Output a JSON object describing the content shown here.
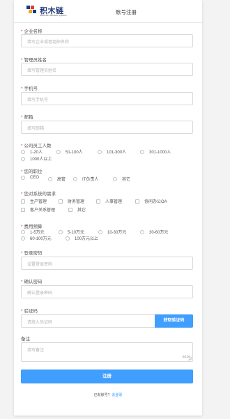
{
  "header": {
    "logo_text": "积木链",
    "logo_sub": "JIMULIAN Software Systems",
    "title": "账号注册"
  },
  "fields": {
    "company": {
      "label": "企业名称",
      "placeholder": "填写企业或者组织名称"
    },
    "admin_name": {
      "label": "管理员姓名",
      "placeholder": "填写管理员姓名"
    },
    "phone": {
      "label": "手机号",
      "placeholder": "填写手机号"
    },
    "email": {
      "label": "邮箱",
      "placeholder": "填写邮箱"
    },
    "password": {
      "label": "登录密码",
      "placeholder": "设置登录密码"
    },
    "confirm": {
      "label": "确认密码",
      "placeholder": "确认登录密码"
    },
    "code": {
      "label": "验证码",
      "placeholder": "请填入验证码",
      "button": "获取验证码"
    },
    "remark": {
      "label": "备注",
      "placeholder": "填写备注",
      "counter": "0/100"
    }
  },
  "employees": {
    "label": "公司员工人数",
    "options": [
      "1-20人",
      "51-100人",
      "101-300人",
      "301-1000人",
      "1000人以上"
    ]
  },
  "position": {
    "label": "您的职位",
    "options": [
      "CEO",
      "高管",
      "IT负责人",
      "其它"
    ]
  },
  "needs": {
    "label": "您对系统的需求",
    "options": [
      "生产管理",
      "财务管理",
      "人事管理",
      "协同办公OA",
      "客户关系管理",
      "其它"
    ]
  },
  "budget": {
    "label": "费用预算",
    "options": [
      "1-5万元",
      "5-10万元",
      "10-30万元",
      "30-60万元",
      "60-100万元",
      "100万元以上"
    ]
  },
  "submit_label": "注册",
  "login": {
    "text": "已有账号?",
    "link": "去登录"
  },
  "colors": {
    "primary": "#409eff",
    "required": "#e53935",
    "logo": "#1f3a7a"
  }
}
